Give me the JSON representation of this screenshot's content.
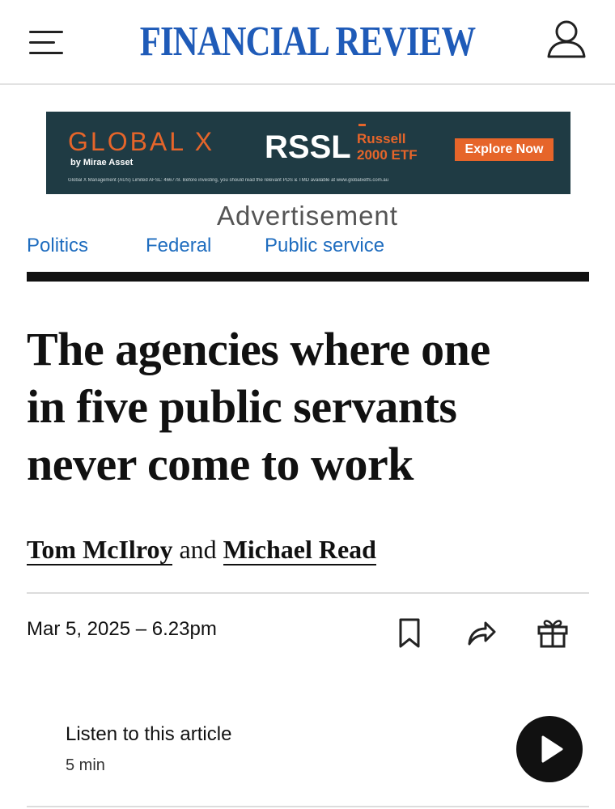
{
  "header": {
    "masthead": "FINANCIAL REVIEW",
    "menu_icon": "hamburger-menu-icon",
    "account_icon": "user-account-icon"
  },
  "ad": {
    "brand": "GLOBAL X",
    "brand_byline": "by Mirae Asset",
    "ticker": "RSSL",
    "product_line1": "Russell",
    "product_line2": "2000 ETF",
    "cta": "Explore Now",
    "disclaimer": "Global X Management (AUS) Limited AFSL: 466778. Before investing, you should read the relevant PDS & TMD available at www.globalxetfs.com.au",
    "label": "Advertisement",
    "colors": {
      "background": "#1f3b44",
      "accent": "#e6652a"
    }
  },
  "breadcrumbs": [
    "Politics",
    "Federal",
    "Public service"
  ],
  "article": {
    "headline_lines": [
      "The agencies where one",
      "in five public servants",
      "never come to work"
    ],
    "authors": [
      "Tom McIlroy",
      "Michael Read"
    ],
    "byline_joiner": "and",
    "date": "Mar 5, 2025 – 6.23pm",
    "tools": [
      "bookmark-icon",
      "share-icon",
      "gift-icon"
    ]
  },
  "audio": {
    "title": "Listen to this article",
    "duration": "5 min",
    "play_icon": "play-icon"
  },
  "colors": {
    "brand_blue": "#1f5bb8",
    "link_blue": "#1f6dbf",
    "text": "#111111"
  }
}
